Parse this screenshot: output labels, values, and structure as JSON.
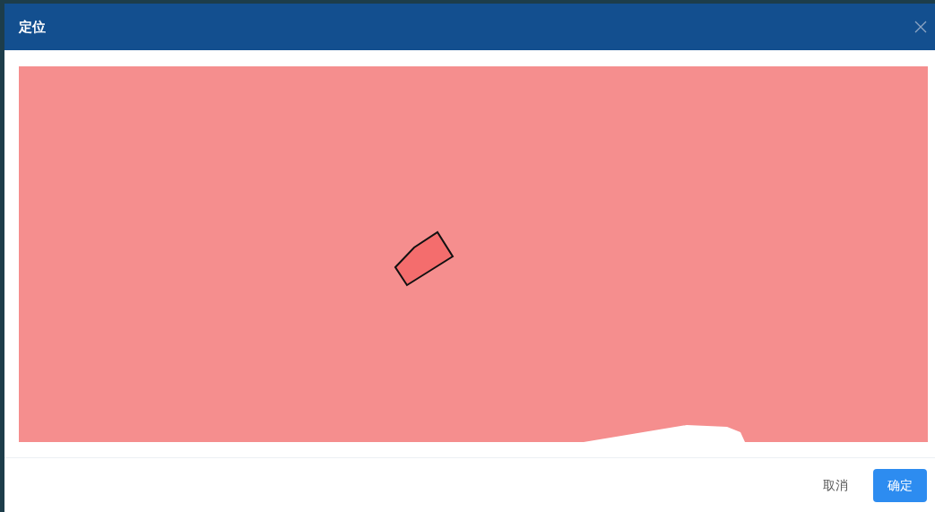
{
  "dialog": {
    "title": "定位"
  },
  "buttons": [
    {
      "label": "取消",
      "kind": "text"
    },
    {
      "label": "确定",
      "kind": "primary"
    }
  ]
}
